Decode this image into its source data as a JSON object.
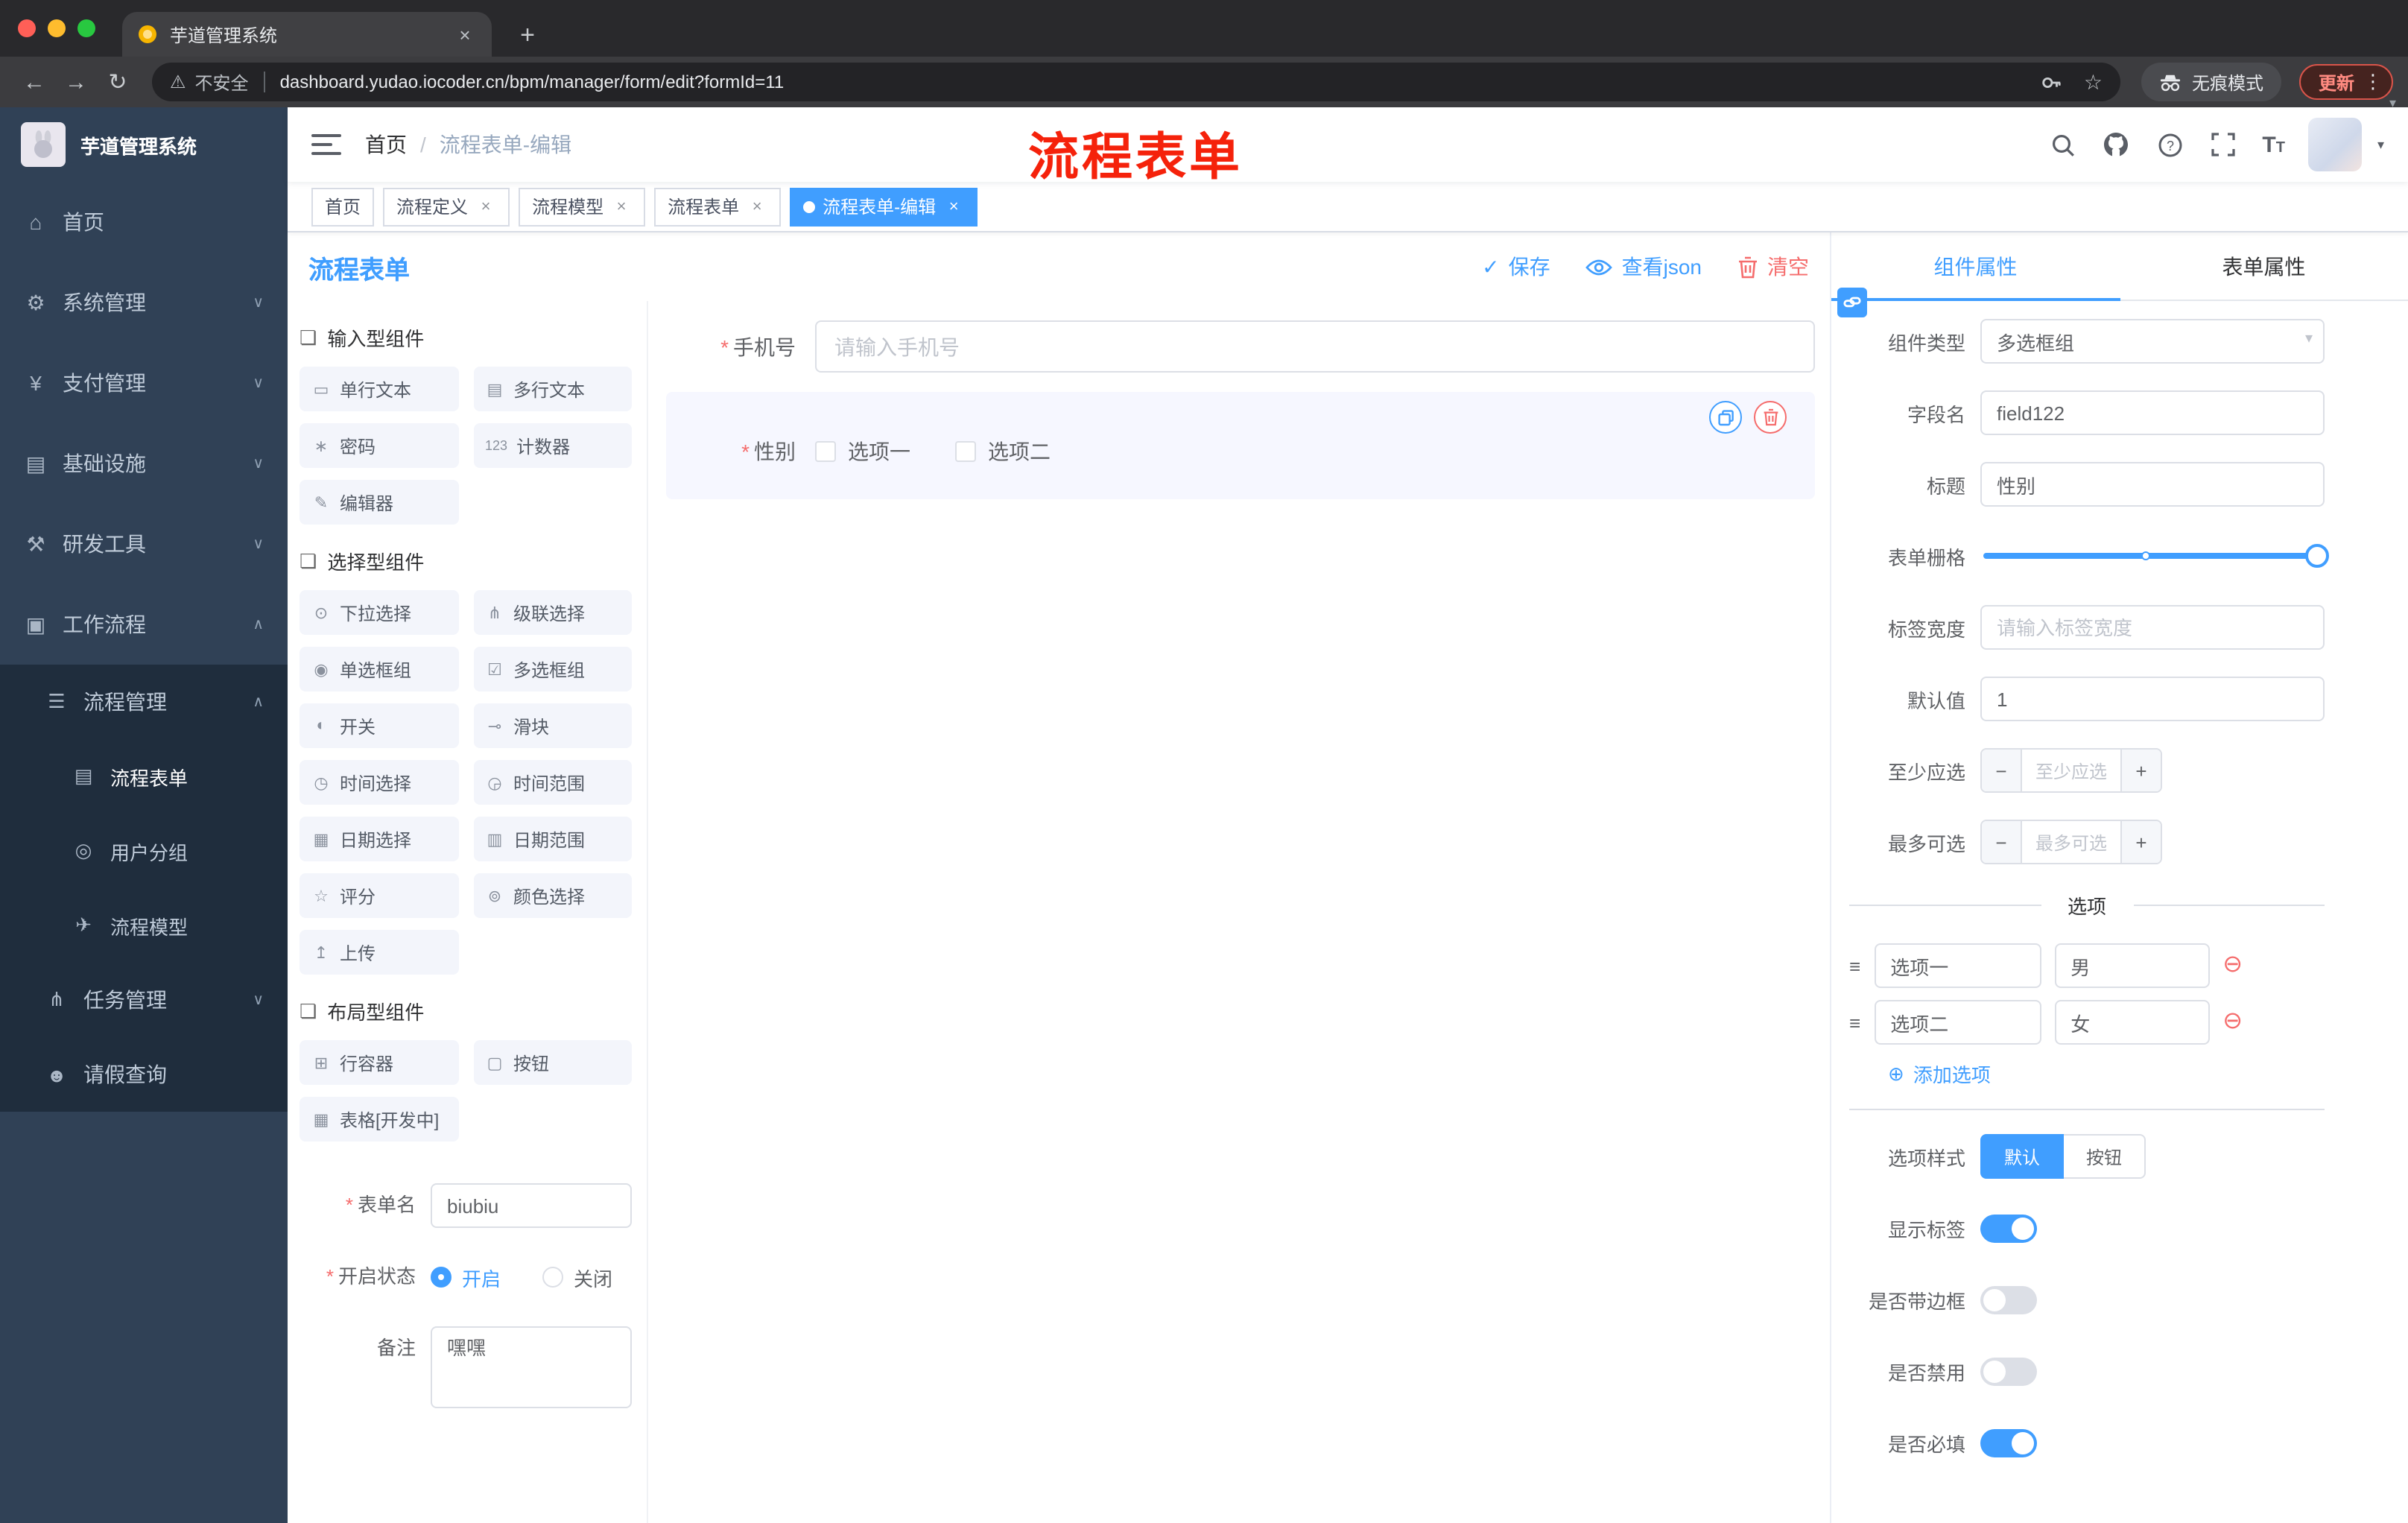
{
  "glyphs": {
    "back": "←",
    "forward": "→",
    "reload": "↻",
    "warning": "⚠",
    "star": "☆",
    "dots": "⋮",
    "plus": "+",
    "close": "×",
    "caret_down": "▾",
    "chev_down": "∨",
    "chev_up": "∧",
    "check": "✓",
    "add": "⊕",
    "remove": "⊖",
    "minus": "−",
    "drag": "≡",
    "slash": "/"
  },
  "browser": {
    "tab_title": "芋道管理系统",
    "security_label": "不安全",
    "url": "dashboard.yudao.iocoder.cn/bpm/manager/form/edit?formId=11",
    "incognito_label": "无痕模式",
    "update_label": "更新"
  },
  "sidebar": {
    "logo_title": "芋道管理系统",
    "items": [
      {
        "label": "首页",
        "icon": "⌂"
      },
      {
        "label": "系统管理",
        "icon": "⚙"
      },
      {
        "label": "支付管理",
        "icon": "¥"
      },
      {
        "label": "基础设施",
        "icon": "▤"
      },
      {
        "label": "研发工具",
        "icon": "⚒"
      },
      {
        "label": "工作流程",
        "icon": "▣"
      }
    ],
    "submenu": {
      "manager": {
        "label": "流程管理",
        "icon": "☰"
      },
      "children": [
        {
          "label": "流程表单",
          "icon": "▤"
        },
        {
          "label": "用户分组",
          "icon": "◎"
        },
        {
          "label": "流程模型",
          "icon": "✈"
        }
      ],
      "task": {
        "label": "任务管理",
        "icon": "⋔"
      },
      "leave": {
        "label": "请假查询",
        "icon": "☻"
      }
    }
  },
  "navbar": {
    "breadcrumb": [
      "首页",
      "流程表单-编辑"
    ],
    "annotation": "流程表单"
  },
  "tags": [
    {
      "label": "首页"
    },
    {
      "label": "流程定义"
    },
    {
      "label": "流程模型"
    },
    {
      "label": "流程表单"
    },
    {
      "label": "流程表单-编辑"
    }
  ],
  "content": {
    "title": "流程表单",
    "save": "保存",
    "view_json": "查看json",
    "clear": "清空"
  },
  "palette": {
    "section_icon": "❏",
    "sections": [
      {
        "title": "输入型组件",
        "items": [
          {
            "label": "单行文本",
            "icon": "▭"
          },
          {
            "label": "多行文本",
            "icon": "▤"
          },
          {
            "label": "密码",
            "icon": "∗"
          },
          {
            "label": "计数器",
            "icon": "123"
          },
          {
            "label": "编辑器",
            "icon": "✎"
          }
        ]
      },
      {
        "title": "选择型组件",
        "items": [
          {
            "label": "下拉选择",
            "icon": "⊙"
          },
          {
            "label": "级联选择",
            "icon": "⋔"
          },
          {
            "label": "单选框组",
            "icon": "◉"
          },
          {
            "label": "多选框组",
            "icon": "☑"
          },
          {
            "label": "开关",
            "icon": "◐"
          },
          {
            "label": "滑块",
            "icon": "⊸"
          },
          {
            "label": "时间选择",
            "icon": "◷"
          },
          {
            "label": "时间范围",
            "icon": "◶"
          },
          {
            "label": "日期选择",
            "icon": "▦"
          },
          {
            "label": "日期范围",
            "icon": "▥"
          },
          {
            "label": "评分",
            "icon": "☆"
          },
          {
            "label": "颜色选择",
            "icon": "⊚"
          },
          {
            "label": "上传",
            "icon": "↥"
          }
        ]
      },
      {
        "title": "布局型组件",
        "items": [
          {
            "label": "行容器",
            "icon": "⊞"
          },
          {
            "label": "按钮",
            "icon": "▢"
          },
          {
            "label": "表格[开发中]",
            "icon": "▦"
          }
        ]
      }
    ]
  },
  "form_meta": {
    "name_label": "表单名",
    "name_value": "biubiu",
    "status_label": "开启状态",
    "status_on": "开启",
    "status_off": "关闭",
    "remark_label": "备注",
    "remark_value": "嘿嘿"
  },
  "canvas": {
    "phone_label": "手机号",
    "phone_placeholder": "请输入手机号",
    "gender_label": "性别",
    "gender_opt1": "选项一",
    "gender_opt2": "选项二"
  },
  "props": {
    "tab_component": "组件属性",
    "tab_form": "表单属性",
    "component_type_label": "组件类型",
    "component_type_value": "多选框组",
    "field_name_label": "字段名",
    "field_name_value": "field122",
    "title_label": "标题",
    "title_value": "性别",
    "grid_label": "表单栅格",
    "label_width_label": "标签宽度",
    "label_width_placeholder": "请输入标签宽度",
    "default_label": "默认值",
    "default_value": "1",
    "min_label": "至少应选",
    "min_placeholder": "至少应选",
    "max_label": "最多可选",
    "max_placeholder": "最多可选",
    "options_title": "选项",
    "options": [
      {
        "label": "选项一",
        "value": "男"
      },
      {
        "label": "选项二",
        "value": "女"
      }
    ],
    "add_option": "添加选项",
    "style_label": "选项样式",
    "style_default": "默认",
    "style_button": "按钮",
    "toggles": [
      {
        "label": "显示标签",
        "on": true
      },
      {
        "label": "是否带边框",
        "on": false
      },
      {
        "label": "是否禁用",
        "on": false
      },
      {
        "label": "是否必填",
        "on": true
      }
    ]
  },
  "colors": {
    "primary": "#409eff",
    "danger": "#f56c6c",
    "annotation": "#f5220b",
    "sidebar": "#304156",
    "submenu": "#1f2d3d"
  }
}
